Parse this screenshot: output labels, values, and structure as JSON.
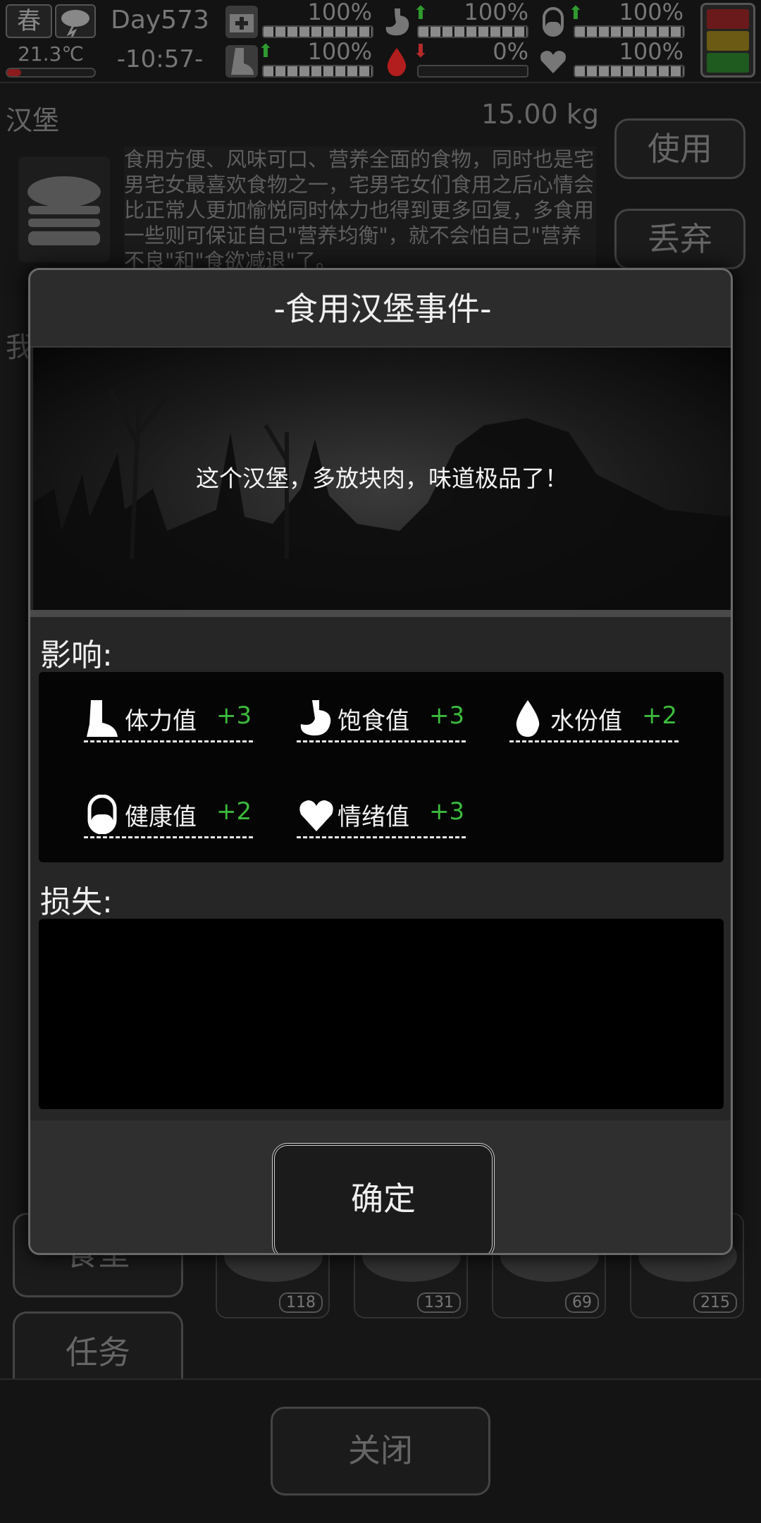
{
  "status": {
    "season": "春",
    "weather_icon": "storm-cloud-icon",
    "temperature": "21.3℃",
    "day": "Day573",
    "time": "-10:57-",
    "stats": [
      {
        "icon": "medkit-icon",
        "percent": "100%",
        "level": 1.0,
        "trend": ""
      },
      {
        "icon": "stomach-icon",
        "percent": "100%",
        "level": 1.0,
        "trend": "up"
      },
      {
        "icon": "pill-icon",
        "percent": "100%",
        "level": 1.0,
        "trend": "up"
      },
      {
        "icon": "boot-icon",
        "percent": "100%",
        "level": 1.0,
        "trend": "up"
      },
      {
        "icon": "water-drop-icon",
        "percent": "0%",
        "level": 0.0,
        "trend": "down"
      },
      {
        "icon": "heart-icon",
        "percent": "100%",
        "level": 1.0,
        "trend": ""
      }
    ]
  },
  "item": {
    "name": "汉堡",
    "weight": "15.00 kg",
    "description": "食用方便、风味可口、营养全面的食物，同时也是宅男宅女最喜欢食物之一，宅男宅女们食用之后心情会比正常人更加愉悦同时体力也得到更多回复，多食用一些则可保证自己\"营养均衡\"，就不会怕自己\"营养不良\"和\"食欲减退\"了。",
    "use_label": "使用",
    "discard_label": "丢弃"
  },
  "background": {
    "partial_label": "我",
    "food_tab_label": "食堂",
    "task_tab_label": "任务",
    "slot_counts": [
      "118",
      "131",
      "69",
      "215"
    ],
    "close_label": "关闭"
  },
  "dialog": {
    "title": "-食用汉堡事件-",
    "message": "这个汉堡，多放块肉，味道极品了！",
    "effects_label": "影响:",
    "losses_label": "损失:",
    "effects": [
      {
        "icon": "boot-icon",
        "name": "体力值",
        "value": "+3"
      },
      {
        "icon": "stomach-icon",
        "name": "饱食值",
        "value": "+3"
      },
      {
        "icon": "water-drop-icon",
        "name": "水份值",
        "value": "+2"
      },
      {
        "icon": "pill-icon",
        "name": "健康值",
        "value": "+2"
      },
      {
        "icon": "heart-icon",
        "name": "情绪值",
        "value": "+3"
      }
    ],
    "confirm_label": "确定"
  },
  "colors": {
    "positive": "#3cba3c",
    "negative": "#b52b2b",
    "trend_up": "#2f9b2f"
  }
}
